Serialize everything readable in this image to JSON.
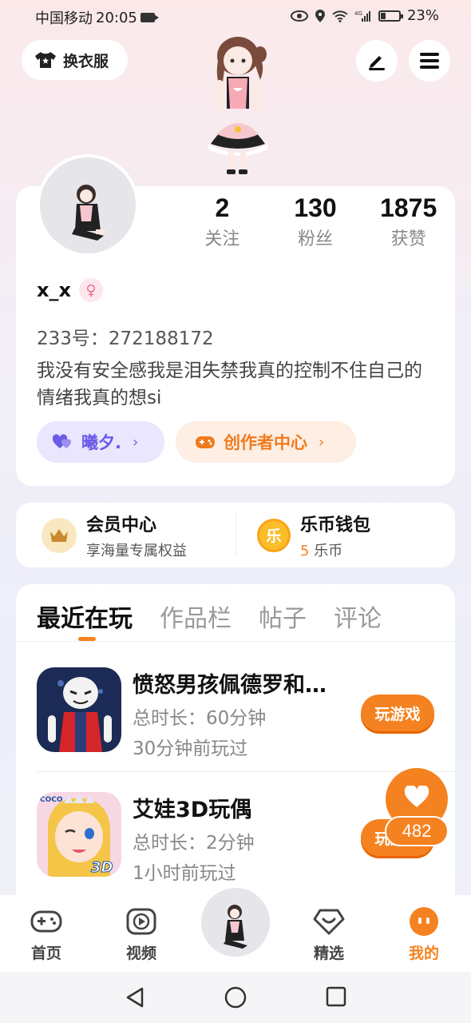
{
  "status_bar": {
    "carrier": "中国移动",
    "time": "20:05",
    "network": "4G",
    "battery": "23%"
  },
  "top_bar": {
    "outfit_label": "换衣服"
  },
  "profile": {
    "stats": [
      {
        "num": "2",
        "label": "关注"
      },
      {
        "num": "130",
        "label": "粉丝"
      },
      {
        "num": "1875",
        "label": "获赞"
      }
    ],
    "username": "x_x",
    "uid": "233号：272188172",
    "bio": "我没有安全感我是泪失禁我真的控制不住自己的情绪我真的想si",
    "pill_friend": "曦夕.",
    "pill_creator": "创作者中心"
  },
  "member": {
    "vip_title": "会员中心",
    "vip_sub": "享海量专属权益",
    "wallet_title": "乐币钱包",
    "wallet_count": "5",
    "wallet_unit": "乐币",
    "coin_char": "乐"
  },
  "tabs": [
    "最近在玩",
    "作品栏",
    "帖子",
    "评论"
  ],
  "games": [
    {
      "title": "愤怒男孩佩德罗和…",
      "duration": "总时长：60分钟",
      "last_played": "30分钟前玩过",
      "button": "玩游戏"
    },
    {
      "title": "艾娃3D玩偶",
      "duration": "总时长：2分钟",
      "last_played": "1小时前玩过",
      "button": "玩游戏",
      "badge_text": "COCO",
      "icon_3d": "3D"
    }
  ],
  "like_count": "482",
  "bottom_nav": [
    "首页",
    "视频",
    "精选",
    "我的"
  ],
  "colors": {
    "accent": "#f58220",
    "friend_pill": "#6a5be8",
    "gender": "#ef6c8d"
  }
}
